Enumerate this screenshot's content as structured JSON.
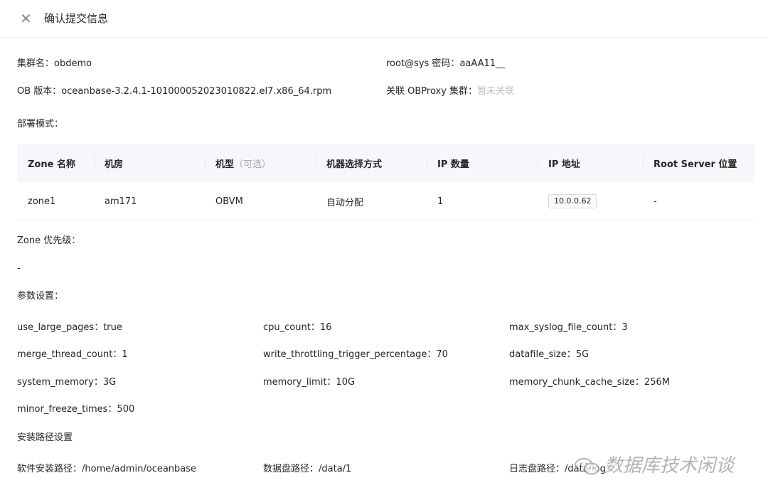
{
  "header": {
    "close_icon": "close-icon",
    "title": "确认提交信息"
  },
  "cluster": {
    "name_label": "集群名：",
    "name_value": "obdemo",
    "password_label": "root@sys 密码：",
    "password_value": "aaAA11__",
    "version_label": "OB 版本：",
    "version_value": "oceanbase-3.2.4.1-101000052023010822.el7.x86_64.rpm",
    "proxy_label": "关联 OBProxy 集群：",
    "proxy_value": "暂未关联"
  },
  "deploy": {
    "label": "部署模式：",
    "columns": [
      "Zone 名称",
      "机房",
      "机型",
      "机器选择方式",
      "IP 数量",
      "IP 地址",
      "Root Server 位置"
    ],
    "machine_type_optional": "（可选）",
    "rows": [
      {
        "zone": "zone1",
        "idc": "am171",
        "machine_type": "OBVM",
        "selection": "自动分配",
        "ip_count": "1",
        "ip": "10.0.0.62",
        "root_server": "-"
      }
    ]
  },
  "zone_priority": {
    "label": "Zone 优先级：",
    "value": "-"
  },
  "params": {
    "label": "参数设置：",
    "items": [
      {
        "name": "use_large_pages：",
        "value": "true"
      },
      {
        "name": "cpu_count：",
        "value": "16"
      },
      {
        "name": "max_syslog_file_count：",
        "value": "3"
      },
      {
        "name": "merge_thread_count：",
        "value": "1"
      },
      {
        "name": "write_throttling_trigger_percentage：",
        "value": "70"
      },
      {
        "name": "datafile_size：",
        "value": "5G"
      },
      {
        "name": "system_memory：",
        "value": "3G"
      },
      {
        "name": "memory_limit：",
        "value": "10G"
      },
      {
        "name": "memory_chunk_cache_size：",
        "value": "256M"
      },
      {
        "name": "minor_freeze_times：",
        "value": "500"
      }
    ]
  },
  "paths": {
    "label": "安装路径设置",
    "install_label": "软件安装路径：",
    "install_value": "/home/admin/oceanbase",
    "data_label": "数据盘路径：",
    "data_value": "/data/1",
    "log_label": "日志盘路径：",
    "log_value": "/data/log"
  },
  "watermark": {
    "text": "数据库技术闲谈"
  }
}
